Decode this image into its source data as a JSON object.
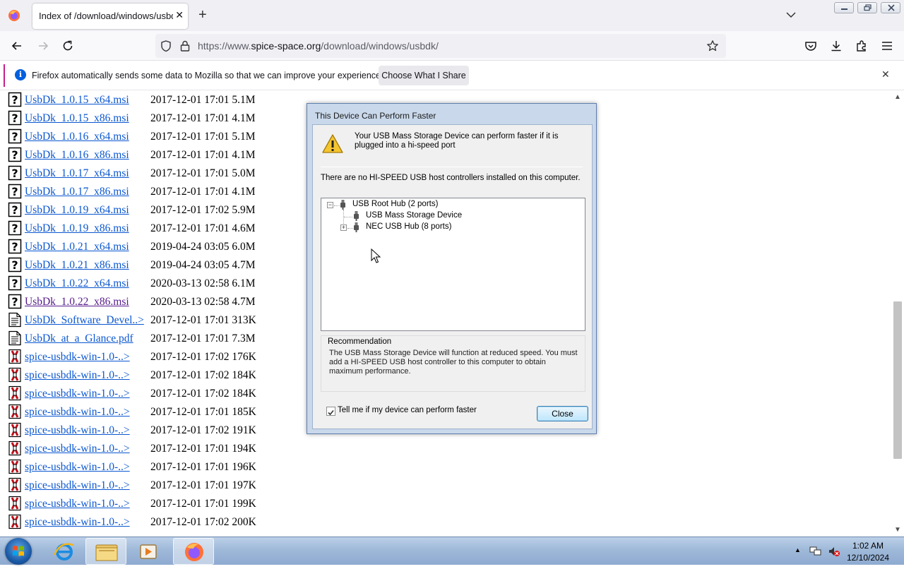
{
  "browser": {
    "tab_title": "Index of /download/windows/usbdk",
    "url_prefix": "https://www.",
    "url_host": "spice-space.org",
    "url_path": "/download/windows/usbdk/"
  },
  "notification": {
    "text": "Firefox automatically sends some data to Mozilla so that we can improve your experience.",
    "button_label": "Choose What I Share",
    "info_glyph": "i"
  },
  "listing": [
    {
      "name": "UsbDk_1.0.15_x64.msi",
      "date": "2017-12-01 17:01",
      "size": "5.1M",
      "icon": "unknown-file-icon"
    },
    {
      "name": "UsbDk_1.0.15_x86.msi",
      "date": "2017-12-01 17:01",
      "size": "4.1M",
      "icon": "unknown-file-icon"
    },
    {
      "name": "UsbDk_1.0.16_x64.msi",
      "date": "2017-12-01 17:01",
      "size": "5.1M",
      "icon": "unknown-file-icon"
    },
    {
      "name": "UsbDk_1.0.16_x86.msi",
      "date": "2017-12-01 17:01",
      "size": "4.1M",
      "icon": "unknown-file-icon"
    },
    {
      "name": "UsbDk_1.0.17_x64.msi",
      "date": "2017-12-01 17:01",
      "size": "5.0M",
      "icon": "unknown-file-icon"
    },
    {
      "name": "UsbDk_1.0.17_x86.msi",
      "date": "2017-12-01 17:01",
      "size": "4.1M",
      "icon": "unknown-file-icon"
    },
    {
      "name": "UsbDk_1.0.19_x64.msi",
      "date": "2017-12-01 17:02",
      "size": "5.9M",
      "icon": "unknown-file-icon"
    },
    {
      "name": "UsbDk_1.0.19_x86.msi",
      "date": "2017-12-01 17:01",
      "size": "4.6M",
      "icon": "unknown-file-icon"
    },
    {
      "name": "UsbDk_1.0.21_x64.msi",
      "date": "2019-04-24 03:05",
      "size": "6.0M",
      "icon": "unknown-file-icon"
    },
    {
      "name": "UsbDk_1.0.21_x86.msi",
      "date": "2019-04-24 03:05",
      "size": "4.7M",
      "icon": "unknown-file-icon"
    },
    {
      "name": "UsbDk_1.0.22_x64.msi",
      "date": "2020-03-13 02:58",
      "size": "6.1M",
      "icon": "unknown-file-icon"
    },
    {
      "name": "UsbDk_1.0.22_x86.msi",
      "date": "2020-03-13 02:58",
      "size": "4.7M",
      "icon": "unknown-file-icon",
      "visited": true
    },
    {
      "name": "UsbDk_Software_Devel..>",
      "date": "2017-12-01 17:01",
      "size": "313K",
      "icon": "text-file-icon"
    },
    {
      "name": "UsbDk_at_a_Glance.pdf",
      "date": "2017-12-01 17:01",
      "size": "7.3M",
      "icon": "text-file-icon"
    },
    {
      "name": "spice-usbdk-win-1.0-..>",
      "date": "2017-12-01 17:02",
      "size": "176K",
      "icon": "compressed-file-icon"
    },
    {
      "name": "spice-usbdk-win-1.0-..>",
      "date": "2017-12-01 17:02",
      "size": "184K",
      "icon": "compressed-file-icon"
    },
    {
      "name": "spice-usbdk-win-1.0-..>",
      "date": "2017-12-01 17:02",
      "size": "184K",
      "icon": "compressed-file-icon"
    },
    {
      "name": "spice-usbdk-win-1.0-..>",
      "date": "2017-12-01 17:01",
      "size": "185K",
      "icon": "compressed-file-icon"
    },
    {
      "name": "spice-usbdk-win-1.0-..>",
      "date": "2017-12-01 17:02",
      "size": "191K",
      "icon": "compressed-file-icon"
    },
    {
      "name": "spice-usbdk-win-1.0-..>",
      "date": "2017-12-01 17:01",
      "size": "194K",
      "icon": "compressed-file-icon"
    },
    {
      "name": "spice-usbdk-win-1.0-..>",
      "date": "2017-12-01 17:01",
      "size": "196K",
      "icon": "compressed-file-icon"
    },
    {
      "name": "spice-usbdk-win-1.0-..>",
      "date": "2017-12-01 17:01",
      "size": "197K",
      "icon": "compressed-file-icon"
    },
    {
      "name": "spice-usbdk-win-1.0-..>",
      "date": "2017-12-01 17:01",
      "size": "199K",
      "icon": "compressed-file-icon"
    },
    {
      "name": "spice-usbdk-win-1.0-..>",
      "date": "2017-12-01 17:02",
      "size": "200K",
      "icon": "compressed-file-icon"
    }
  ],
  "dialog": {
    "title": "This Device Can Perform Faster",
    "message": "Your USB Mass Storage Device can perform faster if it is plugged into a hi-speed port",
    "message2": "There are no HI-SPEED USB host controllers installed on this computer.",
    "tree": {
      "root": "USB Root Hub (2 ports)",
      "child1": "USB Mass Storage Device",
      "child2": "NEC USB Hub (8 ports)"
    },
    "recommendation_title": "Recommendation",
    "recommendation_text": "The USB Mass Storage Device will function at reduced speed. You must add a HI-SPEED USB host controller to this computer to obtain maximum performance.",
    "checkbox_label": "Tell me if my device can perform faster",
    "checkbox_checked": true,
    "close_label": "Close"
  },
  "taskbar": {
    "time": "1:02 AM",
    "date": "12/10/2024",
    "tray_arrow": "▲"
  },
  "colors": {
    "link": "#0b57d0",
    "visited_link": "#551a8b",
    "notification_accent": "#c31e8a",
    "taskbar": "#9fb9d9"
  }
}
